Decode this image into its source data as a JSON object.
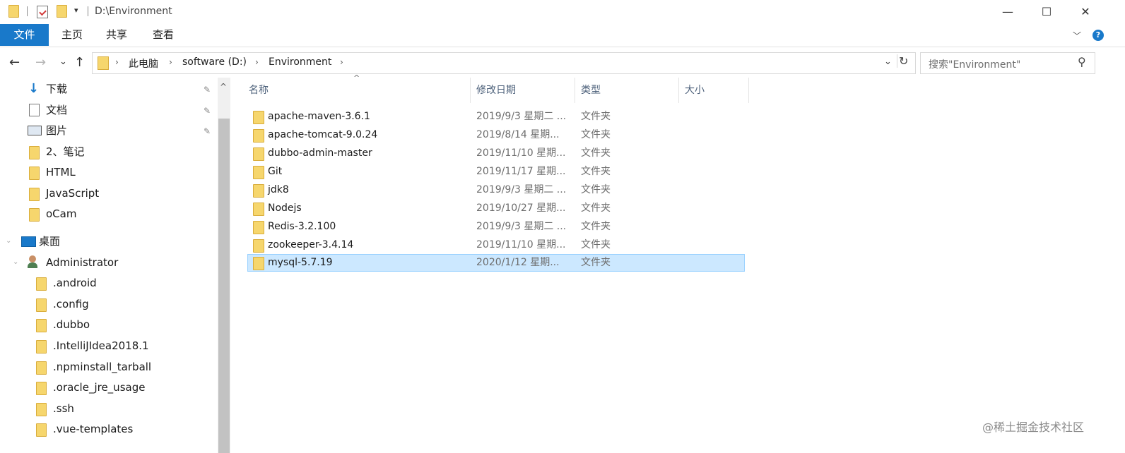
{
  "window": {
    "title": "D:\\Environment",
    "minimize_label": "—",
    "maximize_label": "☐",
    "close_label": "✕"
  },
  "ribbon": {
    "tabs": [
      "文件",
      "主页",
      "共享",
      "查看"
    ],
    "expand_label": "﹀",
    "help_label": "?"
  },
  "address": {
    "back_label": "←",
    "forward_label": "→",
    "recent_label": "⌄",
    "up_label": "↑",
    "crumbs": [
      "此电脑",
      "software (D:)",
      "Environment"
    ],
    "sep": "›",
    "dropdown_label": "⌄",
    "refresh_label": "↻"
  },
  "search": {
    "placeholder": "搜索\"Environment\"",
    "icon": "magnifier"
  },
  "navpane": {
    "pin_glyph": "📌",
    "quick_access": [
      {
        "label": "下载",
        "icon": "download-arrow",
        "pinned": true
      },
      {
        "label": "文档",
        "icon": "document",
        "pinned": true
      },
      {
        "label": "图片",
        "icon": "picture",
        "pinned": true
      },
      {
        "label": "2、笔记",
        "icon": "folder",
        "pinned": false
      },
      {
        "label": "HTML",
        "icon": "folder",
        "pinned": false
      },
      {
        "label": "JavaScript",
        "icon": "folder",
        "pinned": false
      },
      {
        "label": "oCam",
        "icon": "folder",
        "pinned": false
      }
    ],
    "desktop": {
      "label": "桌面",
      "icon": "desktop"
    },
    "admin": {
      "label": "Administrator",
      "icon": "user"
    },
    "admin_children": [
      ".android",
      ".config",
      ".dubbo",
      ".IntelliJIdea2018.1",
      ".npminstall_tarball",
      ".oracle_jre_usage",
      ".ssh",
      ".vue-templates"
    ],
    "scroll_up_label": "^"
  },
  "filelist": {
    "columns": [
      "名称",
      "修改日期",
      "类型",
      "大小"
    ],
    "sort_indicator": "^",
    "rows": [
      {
        "name": "apache-maven-3.6.1",
        "date": "2019/9/3 星期二 ...",
        "type": "文件夹",
        "selected": false
      },
      {
        "name": "apache-tomcat-9.0.24",
        "date": "2019/8/14 星期...",
        "type": "文件夹",
        "selected": false
      },
      {
        "name": "dubbo-admin-master",
        "date": "2019/11/10 星期...",
        "type": "文件夹",
        "selected": false
      },
      {
        "name": "Git",
        "date": "2019/11/17 星期...",
        "type": "文件夹",
        "selected": false
      },
      {
        "name": "jdk8",
        "date": "2019/9/3 星期二 ...",
        "type": "文件夹",
        "selected": false
      },
      {
        "name": "Nodejs",
        "date": "2019/10/27 星期...",
        "type": "文件夹",
        "selected": false
      },
      {
        "name": "Redis-3.2.100",
        "date": "2019/9/3 星期二 ...",
        "type": "文件夹",
        "selected": false
      },
      {
        "name": "zookeeper-3.4.14",
        "date": "2019/11/10 星期...",
        "type": "文件夹",
        "selected": false
      },
      {
        "name": "mysql-5.7.19",
        "date": "2020/1/12 星期...",
        "type": "文件夹",
        "selected": true
      }
    ]
  },
  "watermark": "@稀土掘金技术社区",
  "colors": {
    "accent": "#1979ca",
    "selection": "#cce8ff",
    "folder": "#f6d66d"
  }
}
